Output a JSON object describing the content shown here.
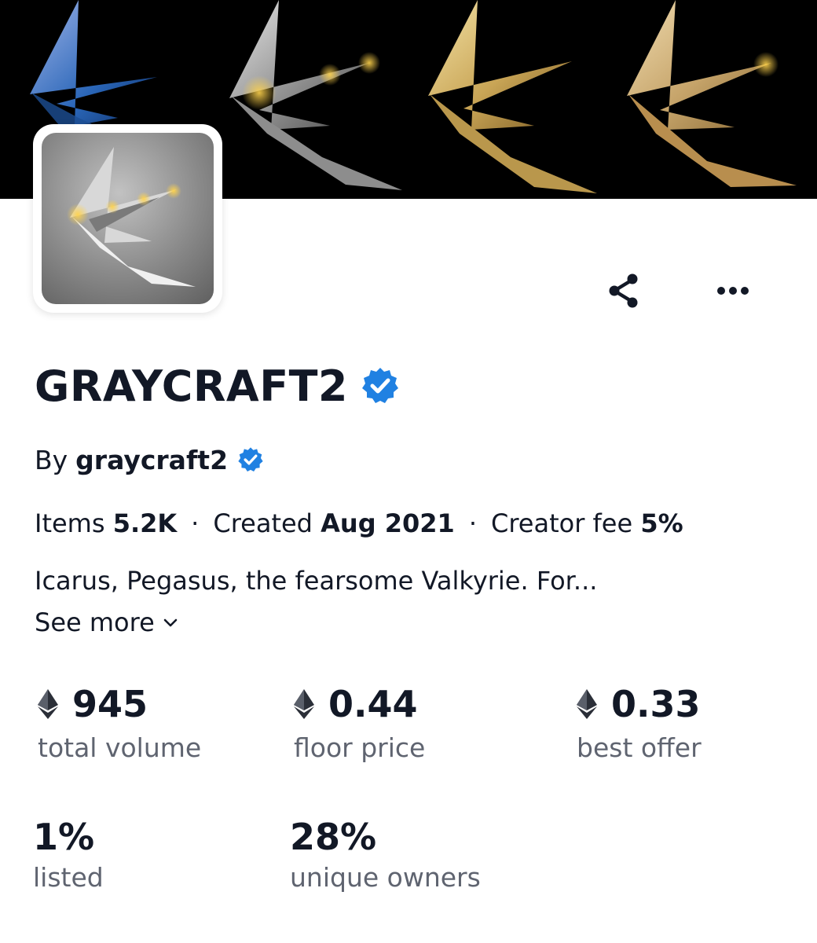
{
  "banner": {
    "background": "#000000"
  },
  "collection": {
    "name": "GRAYCRAFT2",
    "verified": true,
    "by_label": "By",
    "creator": "graycraft2",
    "creator_verified": true
  },
  "meta": {
    "items_label": "Items",
    "items_value": "5.2K",
    "separator": "·",
    "created_label": "Created",
    "created_value": "Aug 2021",
    "fee_label": "Creator fee",
    "fee_value": "5%"
  },
  "description": {
    "text": "Icarus, Pegasus, the fearsome Valkyrie. For...",
    "see_more": "See more"
  },
  "actions": {
    "share_icon": "share-icon",
    "more_icon": "more-horizontal-icon"
  },
  "stats": [
    {
      "value": "945",
      "label": "total volume",
      "icon": "eth-icon"
    },
    {
      "value": "0.44",
      "label": "floor price",
      "icon": "eth-icon"
    },
    {
      "value": "0.33",
      "label": "best offer",
      "icon": "eth-icon"
    },
    {
      "value": "1%",
      "label": "listed"
    },
    {
      "value": "28%",
      "label": "unique owners"
    }
  ],
  "colors": {
    "text": "#121826",
    "muted": "#5f6470",
    "verified": "#2081e2",
    "banner": "#000000"
  }
}
